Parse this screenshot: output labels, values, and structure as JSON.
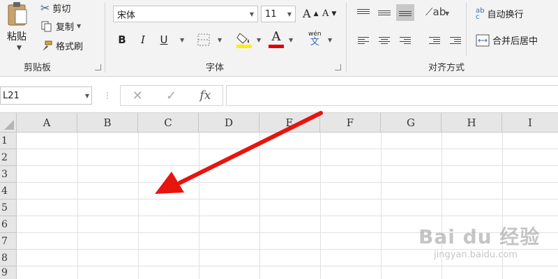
{
  "clipboard": {
    "group_label": "剪贴板",
    "paste_label": "粘贴",
    "cut_label": "剪切",
    "copy_label": "复制",
    "format_painter_label": "格式刷"
  },
  "font": {
    "group_label": "字体",
    "font_name": "宋体",
    "font_size": "11",
    "grow_label": "A",
    "shrink_label": "A",
    "bold_label": "B",
    "italic_label": "I",
    "underline_label": "U",
    "font_color_label": "A",
    "phonetic_top": "wén",
    "phonetic_bottom": "文",
    "fill_color": "#ffee00",
    "font_color": "#e00000"
  },
  "alignment": {
    "group_label": "对齐方式",
    "wrap_text_label": "自动换行",
    "merge_center_label": "合并后居中",
    "wrap_icon_text_top": "ab",
    "wrap_icon_text_bottom": "c"
  },
  "formula_bar": {
    "name_box": "L21",
    "fx_label": "fx",
    "formula_value": ""
  },
  "sheet": {
    "columns": [
      "A",
      "B",
      "C",
      "D",
      "E",
      "F",
      "G",
      "H",
      "I"
    ],
    "rows": [
      "1",
      "2",
      "3",
      "4",
      "5",
      "6",
      "7",
      "8",
      "9"
    ]
  },
  "annotation": {
    "arrow_color": "#e8140e"
  },
  "watermark": {
    "main": "Bai du 经验",
    "sub": "jingyan.baidu.com"
  }
}
